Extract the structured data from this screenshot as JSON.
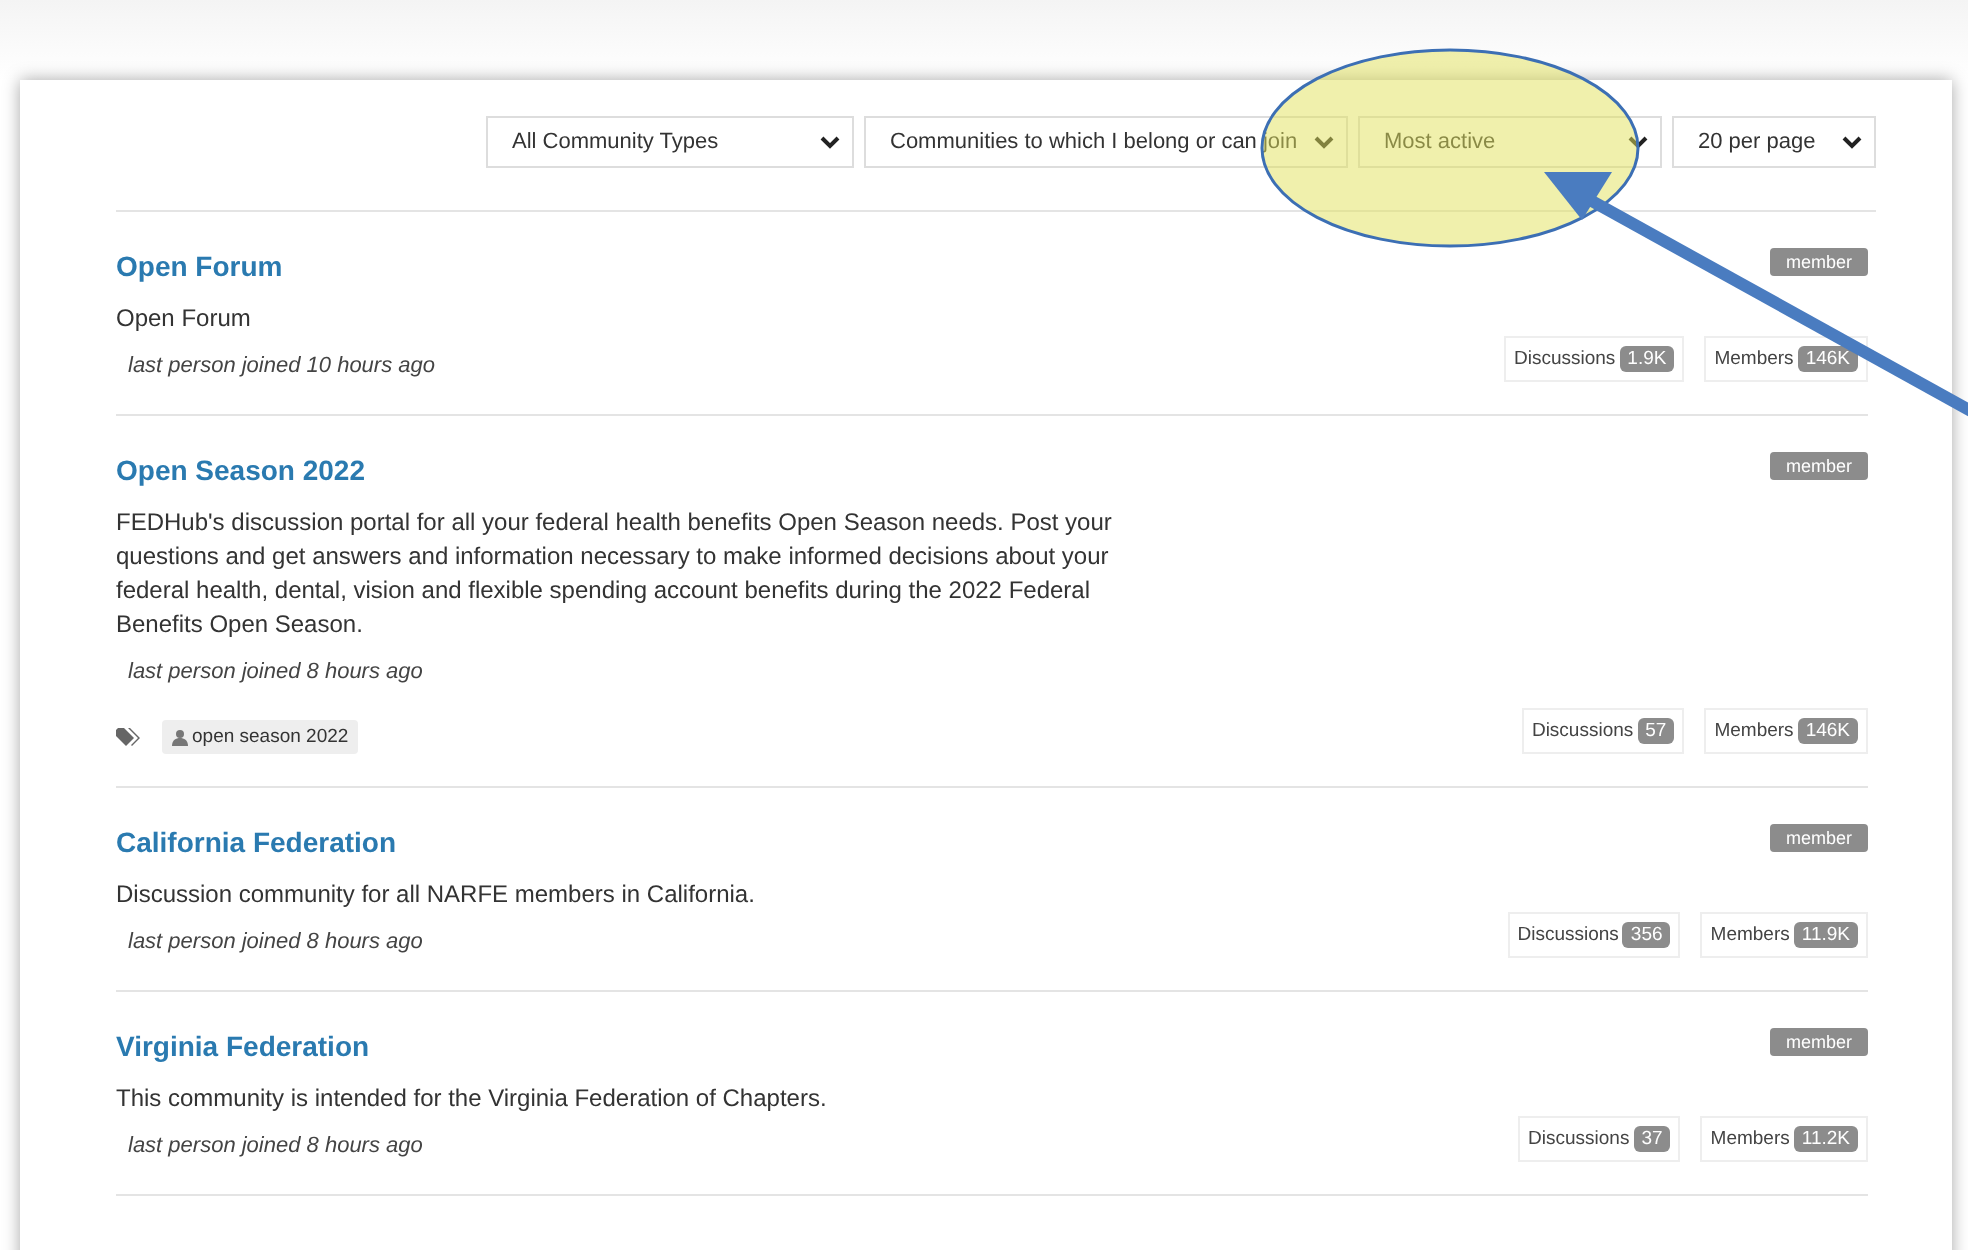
{
  "filters": [
    {
      "value": "All Community Types"
    },
    {
      "value": "Communities to which I belong or can join"
    },
    {
      "value": "Most active"
    },
    {
      "value": "20 per page"
    }
  ],
  "communities": [
    {
      "title": "Open Forum",
      "badge": "member",
      "description": "Open Forum",
      "last_joined": "last person joined 10 hours ago",
      "discussions_label": "Discussions",
      "discussions": "1.9K",
      "members_label": "Members",
      "members": "146K"
    },
    {
      "title": "Open Season 2022",
      "badge": "member",
      "description": "FEDHub's discussion portal for all your federal health benefits Open Season needs. Post your questions and get answers and information necessary to make informed decisions about your federal health, dental, vision and flexible spending account benefits during the 2022 Federal Benefits Open Season.",
      "last_joined": "last person joined 8 hours ago",
      "tags": [
        "open season 2022"
      ],
      "discussions_label": "Discussions",
      "discussions": "57",
      "members_label": "Members",
      "members": "146K"
    },
    {
      "title": "California Federation",
      "badge": "member",
      "description": "Discussion community for all NARFE members in California.",
      "last_joined": "last person joined 8 hours ago",
      "discussions_label": "Discussions",
      "discussions": "356",
      "members_label": "Members",
      "members": "11.9K"
    },
    {
      "title": "Virginia Federation",
      "badge": "member",
      "description": "This community is intended for the Virginia Federation of Chapters.",
      "last_joined": "last person joined 8 hours ago",
      "discussions_label": "Discussions",
      "discussions": "37",
      "members_label": "Members",
      "members": "11.2K"
    }
  ]
}
